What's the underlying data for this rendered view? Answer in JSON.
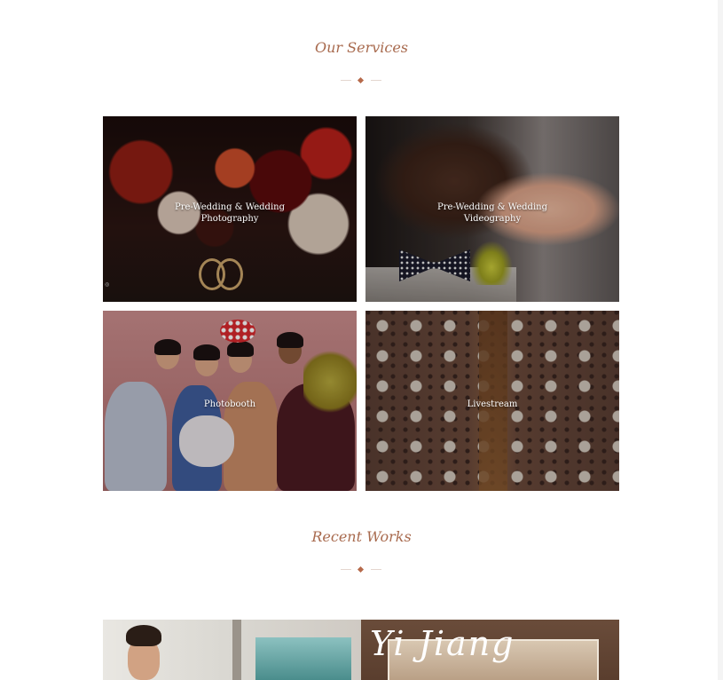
{
  "services": {
    "title": "Our Services",
    "items": [
      {
        "label": "Pre-Wedding & Wedding\nPhotography"
      },
      {
        "label": "Pre-Wedding & Wedding\nVideography"
      },
      {
        "label": "Photobooth"
      },
      {
        "label": "Livestream"
      }
    ]
  },
  "recent": {
    "title": "Recent Works",
    "items": [
      {
        "script_text": ""
      },
      {
        "script_text": "Yi Jiang"
      }
    ]
  },
  "colors": {
    "accent": "#a86a4e",
    "divider": "#b66a4b"
  }
}
